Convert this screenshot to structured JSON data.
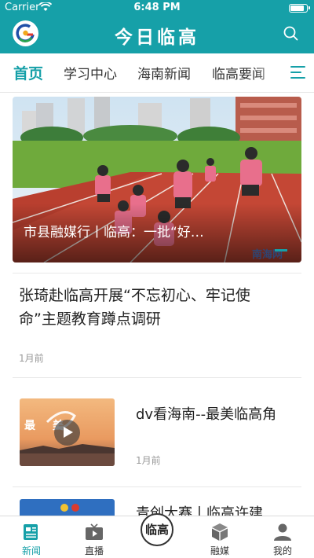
{
  "status_bar": {
    "carrier": "Carrier",
    "time": "6:48 PM"
  },
  "header": {
    "title": "今日临高"
  },
  "tabs": [
    {
      "label": "首页",
      "active": true
    },
    {
      "label": "学习中心"
    },
    {
      "label": "海南新闻"
    },
    {
      "label": "临高要闻"
    }
  ],
  "feed": {
    "hero": {
      "caption": "市县融媒行丨临高：一批“好…",
      "watermark": "南海网"
    },
    "articles": [
      {
        "title": "张琦赴临高开展“不忘初心、牢记使命”主题教育蹲点调研",
        "time": "1月前"
      },
      {
        "title": "dv看海南--最美临高角",
        "time": "1月前",
        "has_video": true,
        "thumb_text": "最美"
      },
      {
        "title": "青创大赛丨临高许建"
      }
    ]
  },
  "bottom_nav": {
    "items": [
      {
        "label": "新闻",
        "icon": "news-icon",
        "active": true
      },
      {
        "label": "直播",
        "icon": "tv-icon"
      },
      {
        "label": "",
        "icon": "center-logo"
      },
      {
        "label": "融媒",
        "icon": "cube-icon"
      },
      {
        "label": "我的",
        "icon": "person-icon"
      }
    ],
    "center_logo_text": "临高"
  },
  "colors": {
    "accent": "#16a0a8",
    "text": "#222222",
    "meta": "#999999"
  }
}
